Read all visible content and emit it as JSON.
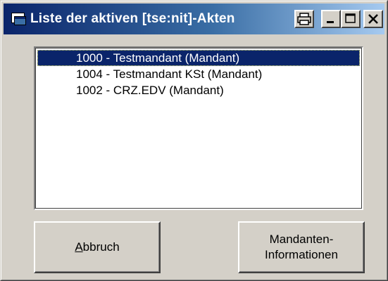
{
  "window": {
    "title": "Liste der aktiven [tse:nit]-Akten",
    "icon": "app-window-icon",
    "caption_buttons": [
      "print-icon",
      "minimize-icon",
      "maximize-icon",
      "close-icon"
    ]
  },
  "list": {
    "items": [
      {
        "label": "1000 - Testmandant (Mandant)",
        "selected": true
      },
      {
        "label": "1004 - Testmandant KSt (Mandant)",
        "selected": false
      },
      {
        "label": "1002 - CRZ.EDV (Mandant)",
        "selected": false
      }
    ]
  },
  "buttons": {
    "cancel": {
      "accel": "A",
      "rest": "bbruch"
    },
    "info": {
      "line1": "Mandanten-",
      "line2": "Informationen"
    }
  },
  "colors": {
    "titlebar_start": "#0a246a",
    "titlebar_end": "#a6caf0",
    "face": "#d4d0c8",
    "selection": "#0a246a"
  }
}
